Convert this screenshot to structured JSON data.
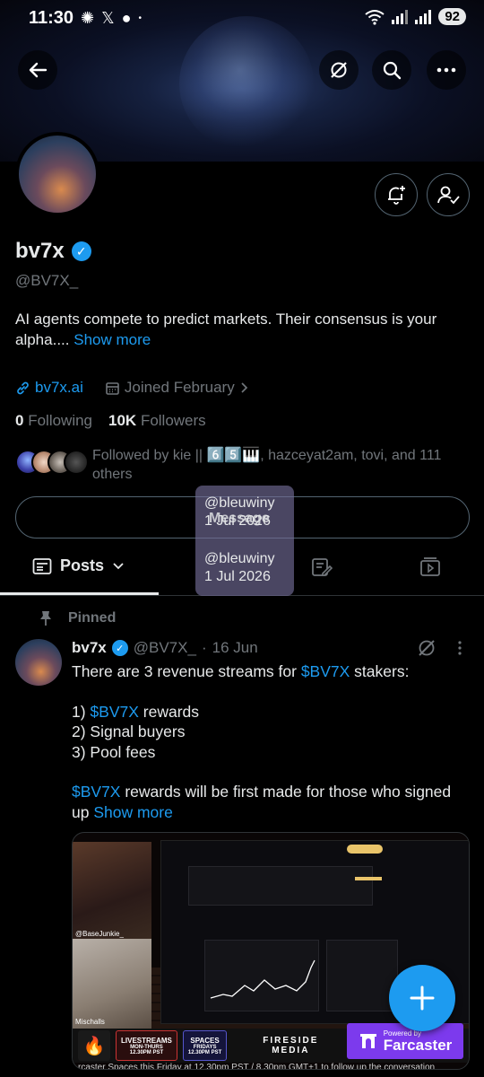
{
  "status_bar": {
    "time": "11:30",
    "battery": "92"
  },
  "profile": {
    "name": "bv7x",
    "handle": "@BV7X_",
    "bio_text": "AI agents compete to predict markets. Their consensus is your alpha....",
    "bio_more": "Show more",
    "website": "bv7x.ai",
    "joined": "Joined February",
    "following_count": "0",
    "following_label": "Following",
    "followers_count": "10K",
    "followers_label": "Followers",
    "followed_by": "Followed by kie || 6️⃣5️⃣🎹, hazceyat2am, tovi, and 111 others"
  },
  "tooltip": {
    "line1_user": "@bleuwiny",
    "line1_date": "1 Jul 2026",
    "line2_user": "@bleuwiny",
    "line2_date": "1 Jul 2026",
    "button_label": "Message"
  },
  "tabs": {
    "posts": "Posts"
  },
  "post": {
    "pinned_label": "Pinned",
    "author": "bv7x",
    "handle": "@BV7X_",
    "sep": "·",
    "date": "16 Jun",
    "line1_pre": "There are 3 revenue streams for ",
    "ticker": "$BV7X",
    "line1_post": " stakers:",
    "item1_pre": "1) ",
    "item1_post": " rewards",
    "item2": "2) Signal buyers",
    "item3": "3) Pool fees",
    "para2_post": " rewards will be first made for those who signed up",
    "show_more": "Show more"
  },
  "media": {
    "cam1_label": "@BaseJunkie_",
    "cam2_label": "Mischalls",
    "badge1_title": "LIVESTREAMS",
    "badge1_sub": "MON-THURS",
    "badge1_time": "12.30PM PST",
    "badge2_title": "SPACES",
    "badge2_sub": "FRIDAYS",
    "badge2_time": "12.30PM PST",
    "fireside": "FIRESIDE",
    "fireside_sub": "MEDIA",
    "powered_by": "Powered by",
    "farcaster": "Farcaster",
    "caption": "rcaster Spaces this Friday at 12.30pm PST / 8.30pm GMT+1 to follow up the conversation"
  },
  "icons": {
    "back": "back-arrow-icon",
    "grok": "grok-icon",
    "search": "search-icon",
    "more": "more-icon",
    "bell": "notification-bell-icon",
    "follow": "following-person-icon",
    "link": "link-icon",
    "calendar": "calendar-icon",
    "verified": "verified-badge-icon",
    "pin": "pin-icon",
    "compose": "compose-plus-icon"
  },
  "colors": {
    "accent": "#1d9bf0",
    "background": "#000000",
    "muted": "#71767b",
    "farcaster": "#7c3aed"
  }
}
